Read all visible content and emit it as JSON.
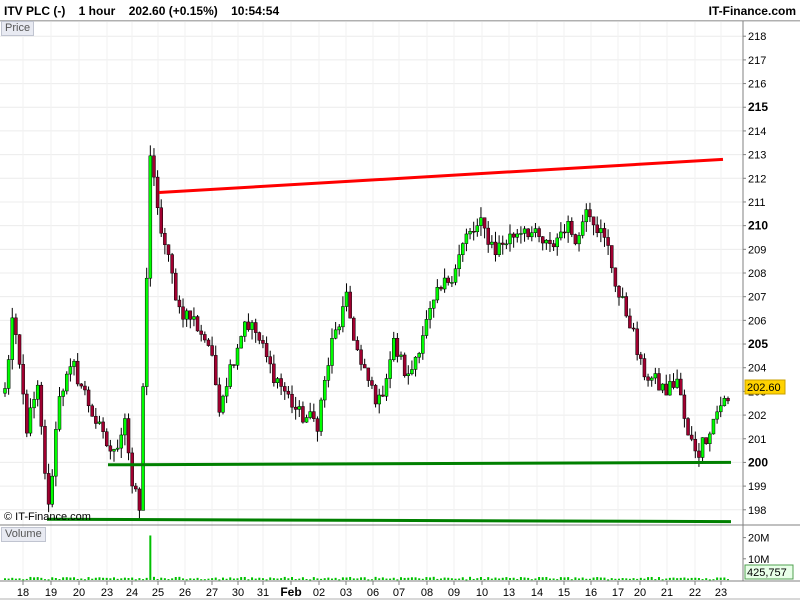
{
  "header": {
    "symbol": "ITV PLC (-)",
    "interval": "1 hour",
    "last_price": "202.60",
    "change": "(+0.15%)",
    "time": "10:54:54",
    "brand": "IT-Finance.com"
  },
  "watermark": "© IT-Finance.com",
  "price_panel": {
    "label": "Price",
    "last_price_tag": "202.60"
  },
  "volume_panel": {
    "label": "Volume",
    "last_volume_tag": "425,757"
  },
  "chart_data": {
    "type": "candlestick",
    "title": "",
    "price_axis": {
      "ylim": [
        197.4,
        218.6
      ],
      "ticks": [
        198,
        199,
        200,
        201,
        202,
        203,
        204,
        205,
        206,
        207,
        208,
        209,
        210,
        211,
        212,
        213,
        214,
        215,
        216,
        217,
        218
      ],
      "bold_ticks": [
        200,
        205,
        210,
        215
      ]
    },
    "volume_axis": {
      "ylim": [
        0,
        25000000
      ],
      "ticks": [
        {
          "value": 10000000,
          "label": "10M"
        },
        {
          "value": 20000000,
          "label": "20M"
        }
      ]
    },
    "date_labels": [
      "18",
      "19",
      "20",
      "23",
      "24",
      "25",
      "26",
      "27",
      "30",
      "31",
      "Feb",
      "02",
      "03",
      "06",
      "07",
      "08",
      "09",
      "10",
      "13",
      "14",
      "15",
      "16",
      "17",
      "20",
      "21",
      "22",
      "23"
    ],
    "candles_count": 200,
    "anchors": [
      [
        0,
        203
      ],
      [
        2,
        206
      ],
      [
        4,
        204
      ],
      [
        6,
        201.5
      ],
      [
        9,
        203
      ],
      [
        12,
        198
      ],
      [
        15,
        203
      ],
      [
        19,
        204
      ],
      [
        23,
        202.5
      ],
      [
        27,
        201
      ],
      [
        30,
        200.3
      ],
      [
        33,
        202
      ],
      [
        35,
        199
      ],
      [
        37,
        198
      ],
      [
        40,
        213
      ],
      [
        42,
        210.5
      ],
      [
        45,
        208.5
      ],
      [
        48,
        206.5
      ],
      [
        52,
        206
      ],
      [
        56,
        205
      ],
      [
        59,
        202.5
      ],
      [
        63,
        204.5
      ],
      [
        66,
        206
      ],
      [
        69,
        205.5
      ],
      [
        73,
        204
      ],
      [
        77,
        203
      ],
      [
        81,
        202
      ],
      [
        86,
        201.7
      ],
      [
        90,
        205
      ],
      [
        94,
        206.8
      ],
      [
        98,
        204
      ],
      [
        103,
        202.5
      ],
      [
        107,
        205
      ],
      [
        111,
        203.5
      ],
      [
        115,
        205.5
      ],
      [
        119,
        207
      ],
      [
        123,
        208
      ],
      [
        127,
        209.5
      ],
      [
        131,
        210
      ],
      [
        135,
        209
      ],
      [
        139,
        209.5
      ],
      [
        143,
        210
      ],
      [
        146,
        209.5
      ],
      [
        150,
        209
      ],
      [
        154,
        210
      ],
      [
        158,
        209.5
      ],
      [
        160,
        211
      ],
      [
        163,
        210
      ],
      [
        166,
        209
      ],
      [
        169,
        207
      ],
      [
        172,
        206
      ],
      [
        175,
        204
      ],
      [
        178,
        203.5
      ],
      [
        182,
        203
      ],
      [
        185,
        203.5
      ],
      [
        188,
        201
      ],
      [
        191,
        200.5
      ],
      [
        194,
        201.5
      ],
      [
        197,
        202.5
      ],
      [
        199,
        202.6
      ]
    ],
    "volume_spikes": [
      {
        "index": 40,
        "value": 21000000
      }
    ],
    "trendlines": [
      {
        "type": "resistance",
        "color": "#ff0000",
        "from": {
          "date_label": "25",
          "price": 211.4
        },
        "to": {
          "date_label": "23",
          "price": 212.8
        }
      },
      {
        "type": "support",
        "color": "#008000",
        "from": {
          "date_label": "23",
          "price": 199.9
        },
        "to": {
          "date_label": "23",
          "price": 200
        }
      },
      {
        "type": "support",
        "color": "#008000",
        "from": {
          "date_label": "19",
          "price": 197.6
        },
        "to": {
          "date_label": "23",
          "price": 197.5
        }
      }
    ],
    "colors": {
      "up": "#00ff00",
      "down": "#a00030",
      "wick": "#000000",
      "volume": "#00c000",
      "price_tag": "#ffd200"
    }
  }
}
